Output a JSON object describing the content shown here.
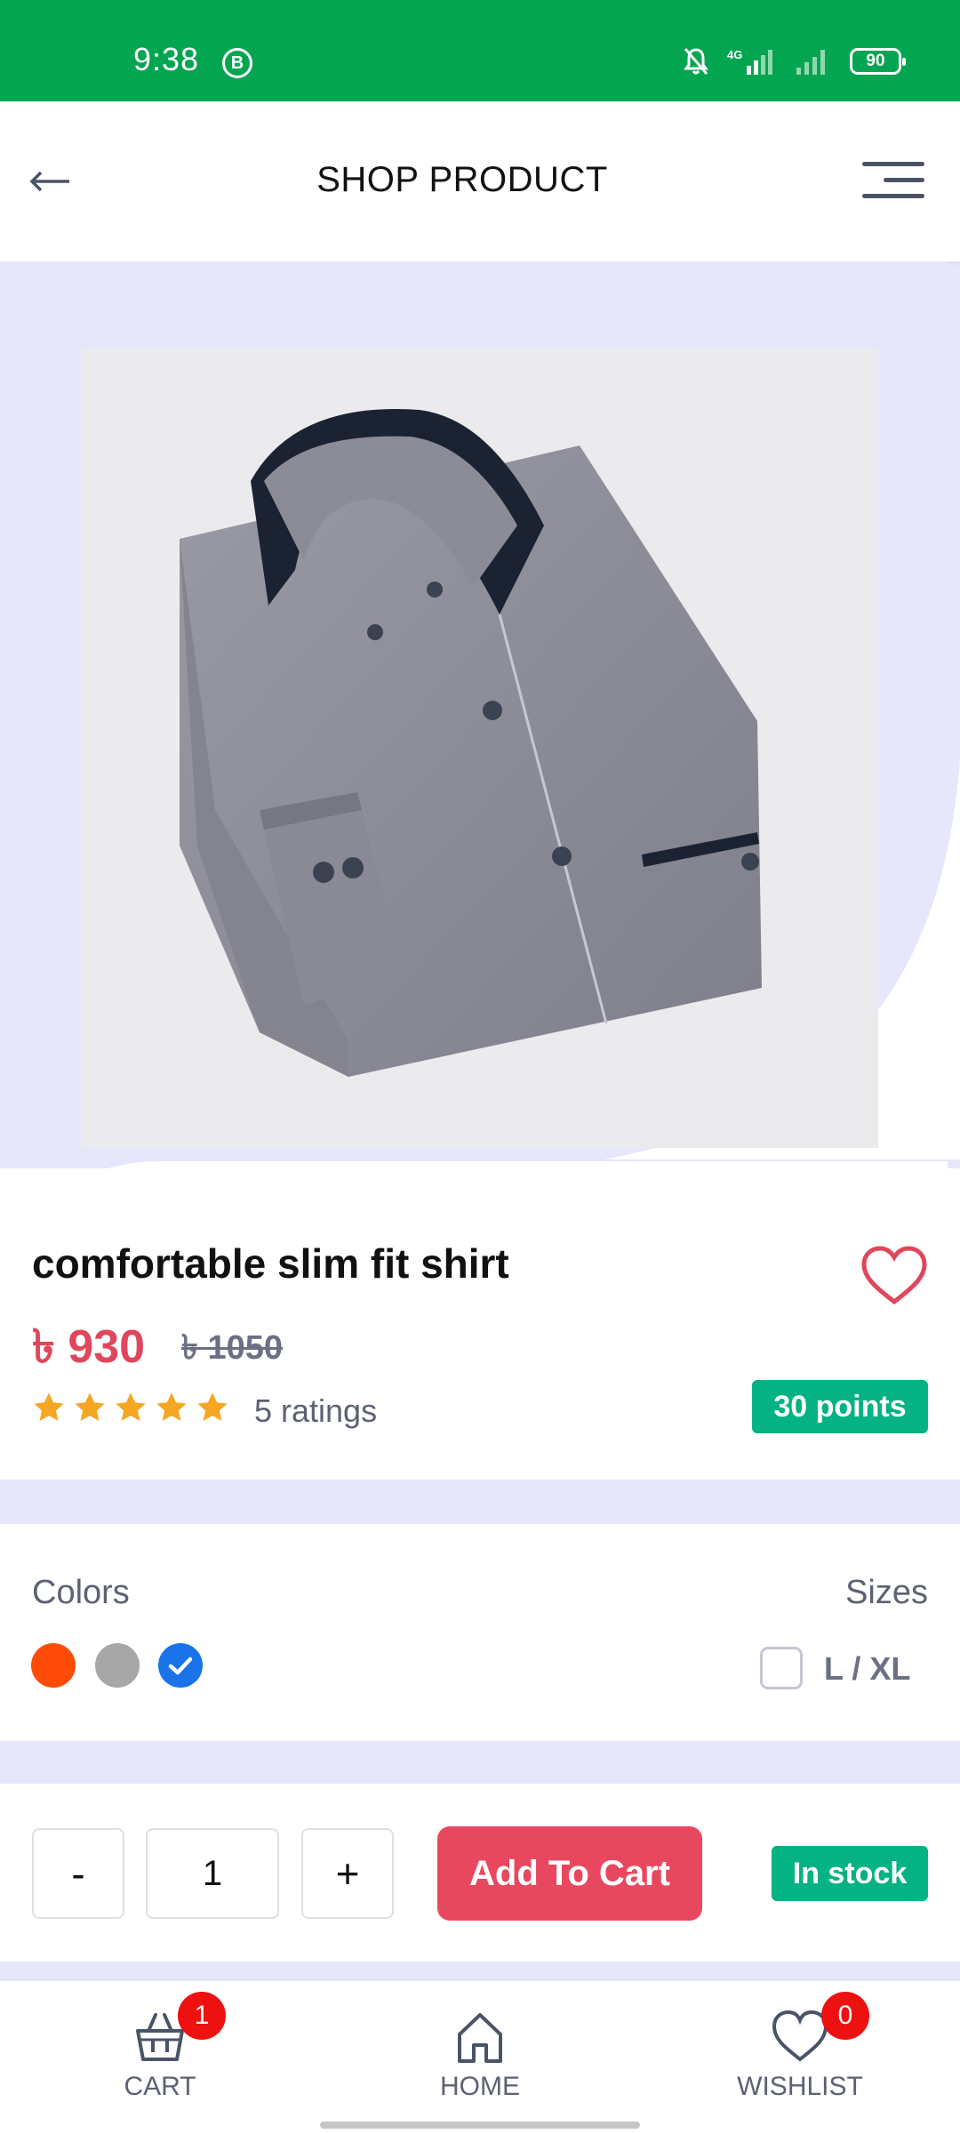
{
  "status": {
    "time": "9:38",
    "indicator": "B",
    "network": "4G",
    "battery": "90"
  },
  "header": {
    "title": "SHOP PRODUCT"
  },
  "product": {
    "name": "comfortable slim fit shirt",
    "price": "৳ 930",
    "old_price": "৳ 1050",
    "rating_stars": 5,
    "ratings_text": "5 ratings",
    "points": "30 points",
    "image_icon": "shirt-photo"
  },
  "options": {
    "colors_label": "Colors",
    "sizes_label": "Sizes",
    "colors": [
      "#fe4b07",
      "#a7a7a7",
      "#1a73e8"
    ],
    "selected_color_index": 2,
    "size": "L / XL"
  },
  "purchase": {
    "minus": "-",
    "quantity": "1",
    "plus": "+",
    "add_to_cart": "Add To Cart",
    "stock": "In stock"
  },
  "nav": {
    "cart_label": "CART",
    "cart_count": "1",
    "home_label": "HOME",
    "wishlist_label": "WISHLIST",
    "wishlist_count": "0"
  },
  "colors": {
    "status_bar": "#04a550",
    "accent_red": "#e8485f",
    "badge_green": "#05b283",
    "page_bg": "#e6e7fb"
  }
}
